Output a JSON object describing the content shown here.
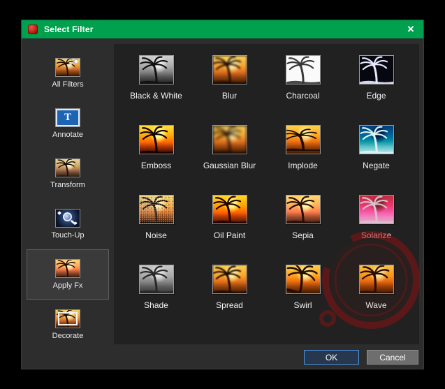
{
  "window": {
    "title": "Select Filter"
  },
  "icons": {
    "close": "×",
    "annotate_letter": "T",
    "transform_arrow": "→"
  },
  "sidebar": {
    "items": [
      {
        "label": "All Filters",
        "selected": false
      },
      {
        "label": "Annotate",
        "selected": false
      },
      {
        "label": "Transform",
        "selected": false
      },
      {
        "label": "Touch-Up",
        "selected": false
      },
      {
        "label": "Apply Fx",
        "selected": true
      },
      {
        "label": "Decorate",
        "selected": false
      }
    ]
  },
  "filters": {
    "items": [
      {
        "label": "Black & White"
      },
      {
        "label": "Blur"
      },
      {
        "label": "Charcoal"
      },
      {
        "label": "Edge"
      },
      {
        "label": "Emboss"
      },
      {
        "label": "Gaussian Blur"
      },
      {
        "label": "Implode"
      },
      {
        "label": "Negate"
      },
      {
        "label": "Noise"
      },
      {
        "label": "Oil Paint"
      },
      {
        "label": "Sepia"
      },
      {
        "label": "Solarize"
      },
      {
        "label": "Shade"
      },
      {
        "label": "Spread"
      },
      {
        "label": "Swirl"
      },
      {
        "label": "Wave"
      }
    ]
  },
  "buttons": {
    "ok": "OK",
    "cancel": "Cancel"
  },
  "colors": {
    "titlebar_green": "#00A14E",
    "ok_border_blue": "#4895E6",
    "watermark_red": "#8C1212"
  }
}
